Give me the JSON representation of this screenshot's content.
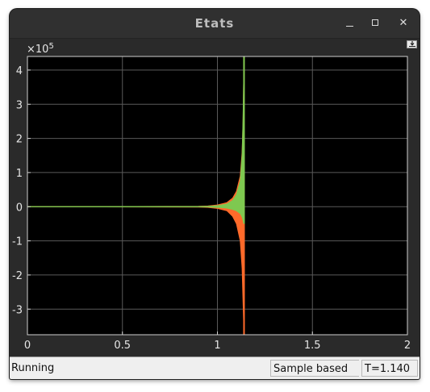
{
  "window": {
    "title": "Etats",
    "controls": {
      "minimize": "minimize-icon",
      "maximize": "maximize-icon",
      "close": "close-icon"
    }
  },
  "plot": {
    "exponent_label": "×10",
    "exponent_power": "5",
    "undock_icon": "undock-arrow-icon",
    "background": "#000000",
    "grid_color": "#5a5a5a",
    "axis_color": "#d0d0d0"
  },
  "chart_data": {
    "type": "line",
    "title": "",
    "xlabel": "",
    "ylabel": "",
    "xlim": [
      0,
      2
    ],
    "ylim": [
      -3.75,
      4.4
    ],
    "y_multiplier": "×10^5",
    "grid": true,
    "x_ticks": [
      "0",
      "0.5",
      "1",
      "1.5",
      "2"
    ],
    "x_tick_values": [
      0,
      0.5,
      1,
      1.5,
      2
    ],
    "y_ticks": [
      "4",
      "3",
      "2",
      "1",
      "0",
      "-1",
      "-2",
      "-3"
    ],
    "y_tick_values": [
      4,
      3,
      2,
      1,
      0,
      -1,
      -2,
      -3
    ],
    "series": [
      {
        "color": "#ff6a2a",
        "envelope": {
          "x": [
            0,
            0.9,
            0.95,
            1.0,
            1.05,
            1.08,
            1.1,
            1.12,
            1.13,
            1.135,
            1.14
          ],
          "upper": [
            0,
            0.01,
            0.02,
            0.05,
            0.12,
            0.25,
            0.45,
            0.9,
            1.6,
            2.5,
            4.4
          ],
          "lower": [
            0,
            -0.01,
            -0.02,
            -0.05,
            -0.12,
            -0.28,
            -0.5,
            -1.0,
            -1.8,
            -2.8,
            -3.75
          ]
        }
      },
      {
        "color": "#7ec850",
        "envelope": {
          "x": [
            0,
            0.9,
            0.95,
            1.0,
            1.05,
            1.08,
            1.1,
            1.12,
            1.13,
            1.135,
            1.14
          ],
          "upper": [
            0,
            0.005,
            0.01,
            0.03,
            0.08,
            0.18,
            0.35,
            0.75,
            1.5,
            2.6,
            4.4
          ],
          "lower": [
            0,
            -0.005,
            -0.008,
            -0.02,
            -0.04,
            -0.08,
            -0.12,
            -0.2,
            -0.3,
            -0.4,
            -0.5
          ]
        }
      }
    ]
  },
  "status": {
    "state": "Running",
    "mode": "Sample based",
    "time": "T=1.140"
  }
}
